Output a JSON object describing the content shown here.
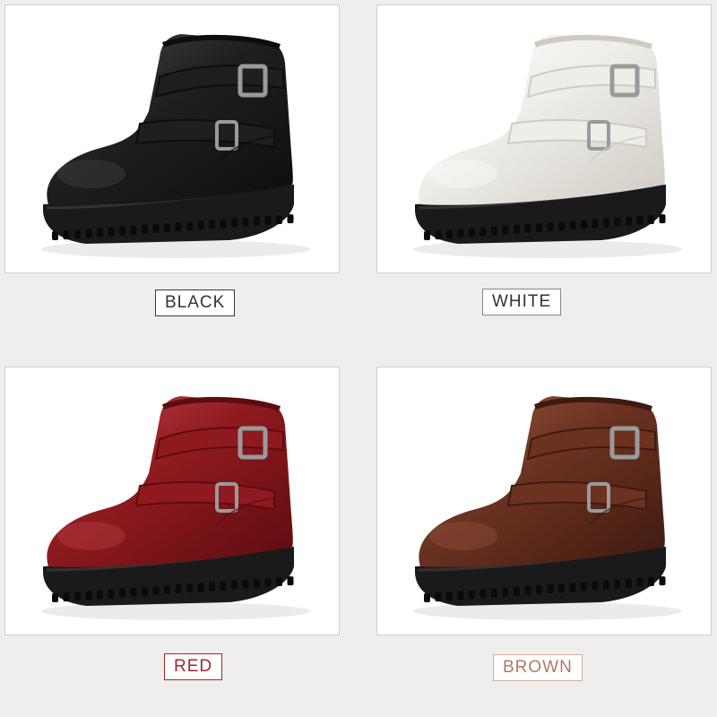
{
  "variants": [
    {
      "label": "BLACK",
      "leather": "#1f1f20",
      "shade": "#0d0d0e",
      "highlight": "#4a4a4c",
      "border": "#3a3a3a",
      "text": "#333333"
    },
    {
      "label": "WHITE",
      "leather": "#efede8",
      "shade": "#cfcbc4",
      "highlight": "#ffffff",
      "border": "#888888",
      "text": "#333333"
    },
    {
      "label": "RED",
      "leather": "#8e1a1f",
      "shade": "#5c0c10",
      "highlight": "#c0454a",
      "border": "#a3262b",
      "text": "#a3262b"
    },
    {
      "label": "BROWN",
      "leather": "#6b3220",
      "shade": "#3e1a10",
      "highlight": "#9a5a42",
      "border": "#d2ad9c",
      "text": "#b07a63"
    }
  ],
  "sole_color": "#1a1a1a"
}
